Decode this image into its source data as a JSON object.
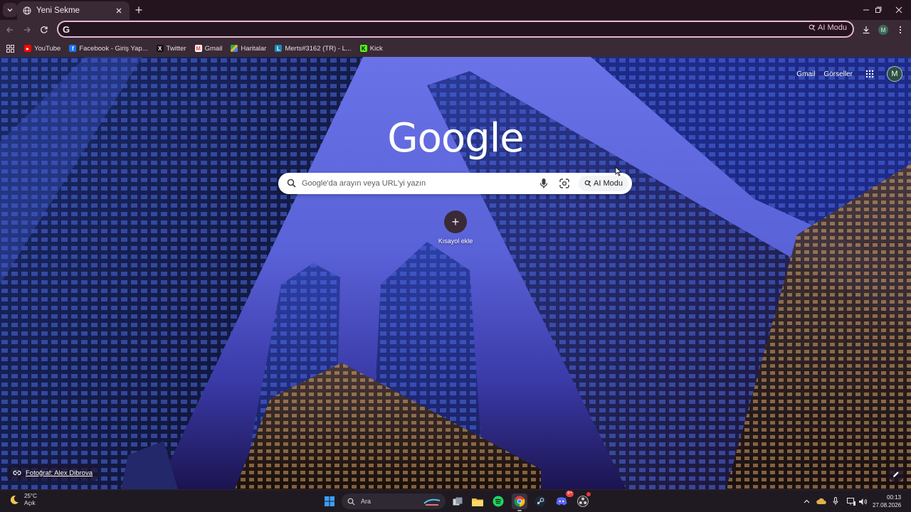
{
  "browser": {
    "tab": {
      "title": "Yeni Sekme"
    },
    "omnibox": {
      "value": "",
      "ai_label": "AI Modu"
    },
    "profile_initial": "M"
  },
  "bookmarks": [
    {
      "label": "YouTube",
      "icon": "youtube-icon",
      "color": "#ff0000"
    },
    {
      "label": "Facebook - Giriş Yap...",
      "icon": "facebook-icon",
      "color": "#1877f2"
    },
    {
      "label": "Twitter",
      "icon": "x-icon",
      "color": "#111111"
    },
    {
      "label": "Gmail",
      "icon": "gmail-icon",
      "color": "#ea4335"
    },
    {
      "label": "Haritalar",
      "icon": "maps-icon",
      "color": "#34a853"
    },
    {
      "label": "Merts#3162 (TR) - L...",
      "icon": "league-icon",
      "color": "#1a8cba"
    },
    {
      "label": "Kick",
      "icon": "kick-icon",
      "color": "#53fc18"
    }
  ],
  "ntp": {
    "top_links": {
      "gmail": "Gmail",
      "images": "Görseller"
    },
    "avatar_initial": "M",
    "logo": "Google",
    "search": {
      "placeholder": "Google'da arayın veya URL'yi yazın",
      "ai_label": "AI Modu"
    },
    "shortcut": {
      "symbol": "+",
      "label": "Kısayol ekle"
    },
    "photo_credit": "Fotoğraf: Alex Dibrova"
  },
  "taskbar": {
    "weather": {
      "temp": "25°C",
      "condition": "Açık"
    },
    "search_label": "Ara",
    "apps": [
      "file-explorer-icon",
      "spotify-icon",
      "chrome-icon",
      "steam-icon",
      "discord-icon",
      "obs-icon"
    ],
    "discord_badge": "9+",
    "clock": {
      "time": "00:13",
      "date": "27.08.2026"
    }
  },
  "colors": {
    "frame": "#24141e",
    "toolbar": "#3a2a35",
    "omnibox_border": "#e3b7d6",
    "accent": "#f1bfe0"
  }
}
